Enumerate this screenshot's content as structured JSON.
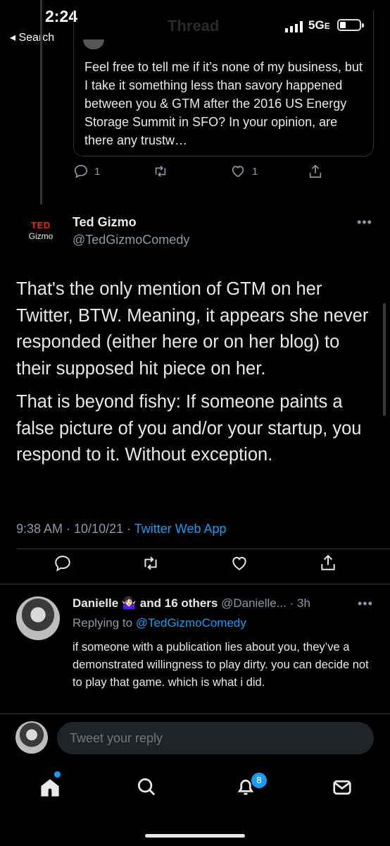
{
  "status_bar": {
    "time": "2:24",
    "back_label": "◂ Search",
    "network": "5G",
    "network_suffix": "E"
  },
  "header": {
    "title": "Thread"
  },
  "quoted_tweet": {
    "text": "Feel free to tell me if it’s none of my business, but I take it something less than savory happened between you & GTM after the 2016 US Energy Storage Summit in SFO?  In your opinion, are there any trustw…",
    "reply_count": "1",
    "like_count": "1"
  },
  "main_tweet": {
    "logo_top": "TED",
    "logo_bottom": "Gizmo",
    "author_name": "Ted Gizmo",
    "author_handle": "@TedGizmoComedy",
    "more": "•••",
    "paragraphs": [
      "That's the only mention of GTM on her Twitter, BTW. Meaning, it appears she never responded (either here or on her blog) to their supposed hit piece on her.",
      "That is beyond fishy: If someone paints a false picture of you and/or your startup, you respond to it. Without exception."
    ],
    "time": "9:38 AM · 10/10/21 · ",
    "source": "Twitter Web App"
  },
  "reply": {
    "author_name": "Danielle 🤷🏻‍♀️ and 16 others",
    "author_handle": "@Danielle... · 3h",
    "replying_prefix": "Replying to ",
    "replying_to": "@TedGizmoComedy",
    "text": "if someone with a publication lies about you, they’ve a demonstrated willingness to play dirty. you can decide not to play that game. which is what i did.",
    "more": "•••"
  },
  "composer": {
    "placeholder": "Tweet your reply"
  },
  "bottom_nav": {
    "notifications_badge": "8"
  },
  "colors": {
    "background": "#000000",
    "accent": "#1d9bf0",
    "secondary_text": "#8b98a5",
    "ted_red": "#e62b1e"
  }
}
